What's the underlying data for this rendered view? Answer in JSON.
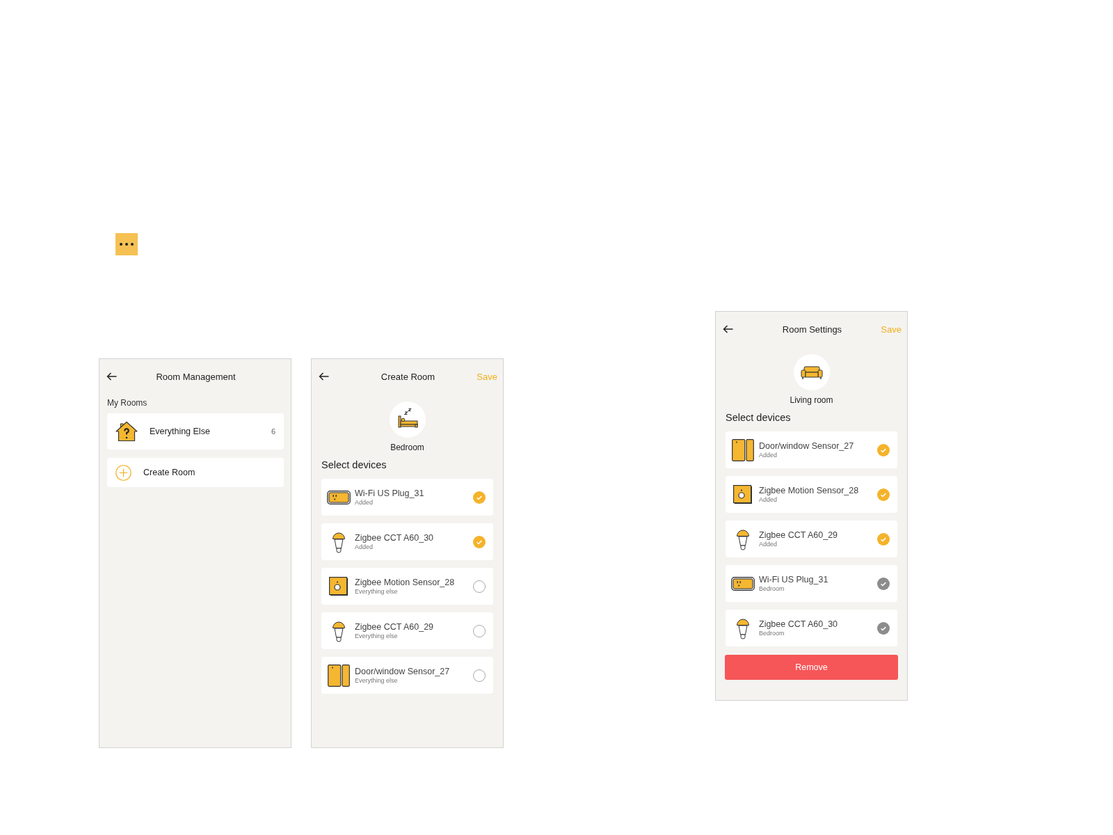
{
  "screens": [
    {
      "kind": "room_list",
      "header": {
        "title": "Room Management"
      },
      "section_label": "My Rooms",
      "rooms": [
        {
          "name": "Everything Else",
          "count": "6"
        }
      ],
      "create_label": "Create Room"
    },
    {
      "kind": "room_editor",
      "header": {
        "title": "Create Room",
        "action": "Save"
      },
      "room": {
        "kind": "bedroom",
        "name": "Bedroom"
      },
      "section_label": "Select devices",
      "devices": [
        {
          "kind": "plug",
          "name": "Wi-Fi US Plug_31",
          "status": "Added",
          "selected": true,
          "disabled": false
        },
        {
          "kind": "bulb",
          "name": "Zigbee CCT A60_30",
          "status": "Added",
          "selected": true,
          "disabled": false
        },
        {
          "kind": "motion_sensor",
          "name": "Zigbee Motion Sensor_28",
          "status": "Everything else",
          "selected": false,
          "disabled": false
        },
        {
          "kind": "bulb",
          "name": "Zigbee CCT A60_29",
          "status": "Everything else",
          "selected": false,
          "disabled": false
        },
        {
          "kind": "door_sensor",
          "name": "Door/window Sensor_27",
          "status": "Everything else",
          "selected": false,
          "disabled": false
        }
      ]
    },
    {
      "kind": "room_editor",
      "header": {
        "title": "Room Settings",
        "action": "Save"
      },
      "room": {
        "kind": "living_room",
        "name": "Living room"
      },
      "section_label": "Select devices",
      "devices": [
        {
          "kind": "door_sensor",
          "name": "Door/window Sensor_27",
          "status": "Added",
          "selected": true,
          "disabled": false
        },
        {
          "kind": "motion_sensor",
          "name": "Zigbee Motion Sensor_28",
          "status": "Added",
          "selected": true,
          "disabled": false
        },
        {
          "kind": "bulb",
          "name": "Zigbee CCT A60_29",
          "status": "Added",
          "selected": true,
          "disabled": false
        },
        {
          "kind": "plug",
          "name": "Wi-Fi US Plug_31",
          "status": "Bedroom",
          "selected": true,
          "disabled": true
        },
        {
          "kind": "bulb",
          "name": "Zigbee CCT A60_30",
          "status": "Bedroom",
          "selected": true,
          "disabled": true
        }
      ],
      "remove_label": "Remove"
    }
  ]
}
